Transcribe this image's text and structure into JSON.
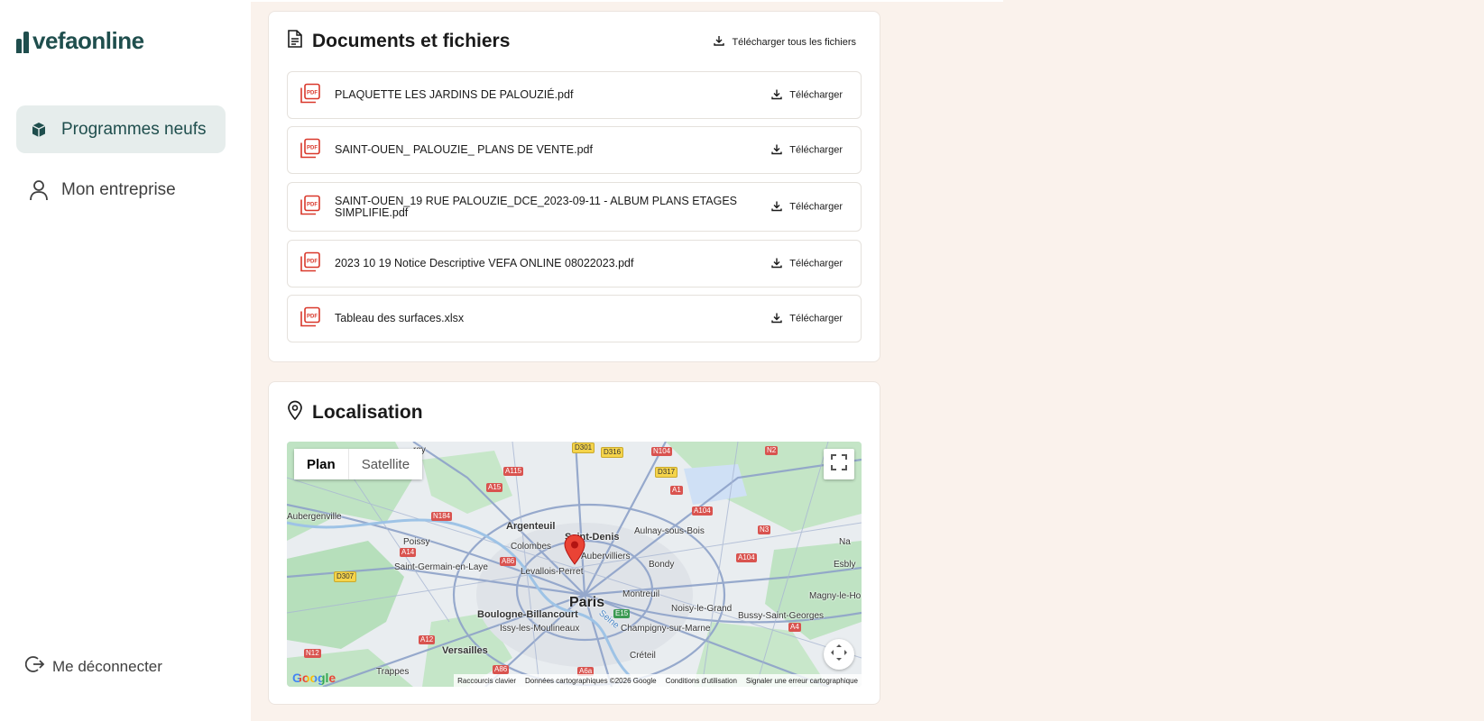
{
  "brand": {
    "name": "vefaonline",
    "color": "#1f4e4d"
  },
  "nav": {
    "items": [
      {
        "label": "Programmes neufs",
        "icon": "box-icon",
        "active": true
      },
      {
        "label": "Mon entreprise",
        "icon": "user-icon",
        "active": false
      }
    ],
    "logout_label": "Me déconnecter"
  },
  "documents": {
    "title": "Documents et fichiers",
    "download_all_label": "Télécharger tous les fichiers",
    "download_label": "Télécharger",
    "files": [
      {
        "name": "PLAQUETTE LES JARDINS DE PALOUZIÉ.pdf"
      },
      {
        "name": "SAINT-OUEN_ PALOUZIE_ PLANS DE VENTE.pdf"
      },
      {
        "name": "SAINT-OUEN_19 RUE PALOUZIE_DCE_2023-09-11 - ALBUM PLANS ETAGES SIMPLIFIE.pdf"
      },
      {
        "name": "2023 10 19 Notice Descriptive VEFA ONLINE 08022023.pdf"
      },
      {
        "name": "Tableau des surfaces.xlsx"
      }
    ]
  },
  "location": {
    "title": "Localisation",
    "map_types": [
      "Plan",
      "Satellite"
    ],
    "selected_map_type": "Plan",
    "places": {
      "paris": "Paris",
      "saint_denis": "Saint-Denis",
      "aubervilliers": "Aubervilliers",
      "argenteuil": "Argenteuil",
      "colombes": "Colombes",
      "levallois": "Levallois-Perret",
      "boulogne": "Boulogne-Billancourt",
      "issy": "Issy-les-Moulineaux",
      "versailles": "Versailles",
      "trappes": "Trappes",
      "saint_germain": "Saint-Germain-en-Laye",
      "poissy": "Poissy",
      "aubergenville": "Aubergenville",
      "aulnay": "Aulnay-sous-Bois",
      "bondy": "Bondy",
      "montreuil": "Montreuil",
      "noisy": "Noisy-le-Grand",
      "champigny": "Champigny-sur-Marne",
      "creteil": "Créteil",
      "bussy": "Bussy-Saint-Georges",
      "esbly": "Esbly",
      "magny": "Magny-le-Ho",
      "na": "Na",
      "rgy": "rgy",
      "seine": "Seine"
    },
    "roads": [
      "D301",
      "D316",
      "N104",
      "N2",
      "D317",
      "A115",
      "A15",
      "A1",
      "N184",
      "A104",
      "N3",
      "A14",
      "A86",
      "D307",
      "A104",
      "E15",
      "A12",
      "A4",
      "N12",
      "A86",
      "A6a"
    ],
    "attribution": {
      "google": "Google",
      "shortcuts": "Raccourcis clavier",
      "data": "Données cartographiques ©2026 Google",
      "terms": "Conditions d'utilisation",
      "report": "Signaler une erreur cartographique"
    }
  },
  "colors": {
    "background": "#faf2ec",
    "active_nav": "#e6edec",
    "pdf_red": "#d9382b",
    "marker_red": "#ea4335"
  }
}
